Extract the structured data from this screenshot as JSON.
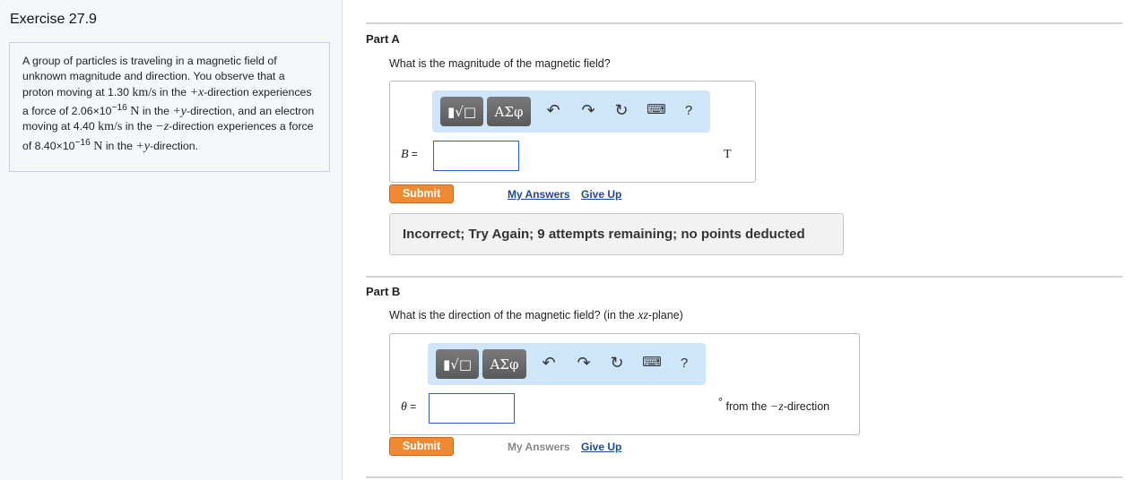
{
  "exercise_title": "Exercise 27.9",
  "problem": {
    "t1": "A group of particles is traveling in a magnetic field of unknown magnitude and direction. You observe that a proton moving at 1.30 ",
    "unit_kms": "km/s",
    "t2": " in the ",
    "plus_x": "+x",
    "t3": "-direction experiences a force of 2.06×10",
    "exp1": "−16",
    "unit_N": "N",
    "t4": " in the ",
    "plus_y": "+y",
    "t5": "-direction, and an electron moving at 4.40 ",
    "t6": " in the ",
    "minus_z": "−z",
    "t7": "-direction experiences a force of 8.40×10",
    "exp2": "−16",
    "t8": " in the ",
    "t9": "-direction."
  },
  "partA": {
    "title": "Part A",
    "question": "What is the magnitude of the magnetic field?",
    "toolbar": {
      "templates": "▮√□",
      "greek": "ΑΣφ",
      "help": "?"
    },
    "var": "B",
    "eq": " =",
    "value": "",
    "unit": "T",
    "submit": "Submit",
    "my_answers": "My Answers",
    "give_up": "Give Up",
    "feedback": "Incorrect; Try Again; 9 attempts remaining; no points deducted"
  },
  "partB": {
    "title": "Part B",
    "question_pre": "What is the direction of the magnetic field? (in the ",
    "plane": "xz",
    "question_post": "-plane)",
    "toolbar": {
      "templates": "▮√□",
      "greek": "ΑΣφ",
      "help": "?"
    },
    "var": "θ",
    "eq": " =",
    "value": "",
    "unit_deg": "°",
    "unit_pre": " from the ",
    "unit_dir": "−z",
    "unit_post": "-direction",
    "submit": "Submit",
    "my_answers": "My Answers",
    "give_up": "Give Up"
  }
}
